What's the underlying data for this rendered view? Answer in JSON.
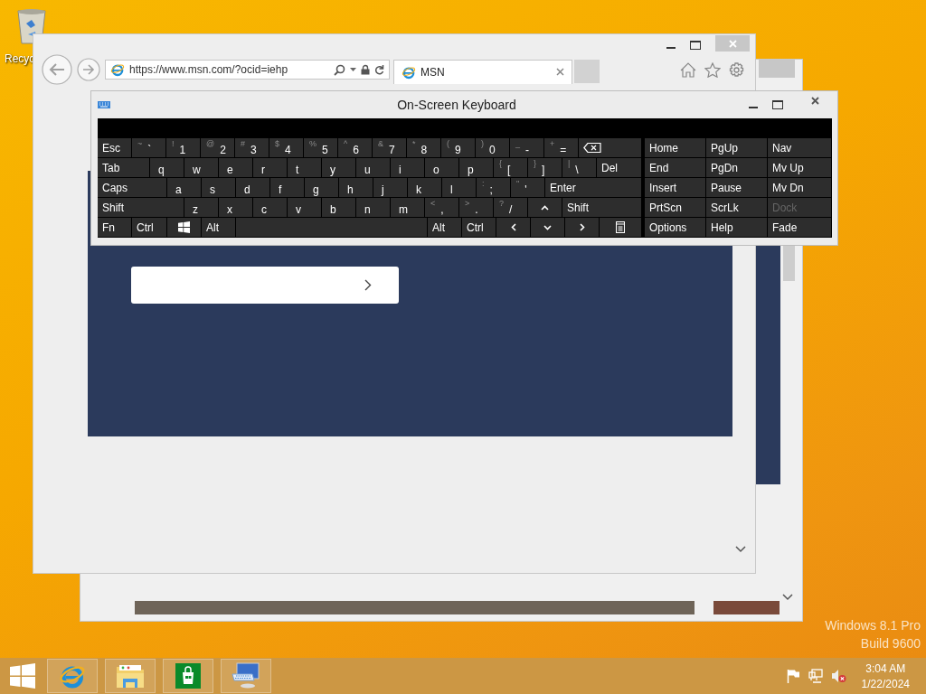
{
  "desktop": {
    "icons": [
      {
        "label": "Recyc"
      }
    ],
    "edition_text": [
      "Windows 8.1 Pro",
      "Build 9600"
    ]
  },
  "browser": {
    "address": "https://www.msn.com/?ocid=iehp",
    "tabs": [
      {
        "label": "MSN",
        "selected": true
      }
    ]
  },
  "keyboard": {
    "title": "On-Screen Keyboard",
    "rows": [
      {
        "keys": [
          {
            "kind": "text",
            "label": "Esc"
          },
          {
            "kind": "char",
            "main": "`",
            "shift": "~"
          },
          {
            "kind": "char",
            "main": "1",
            "shift": "!"
          },
          {
            "kind": "char",
            "main": "2",
            "shift": "@"
          },
          {
            "kind": "char",
            "main": "3",
            "shift": "#"
          },
          {
            "kind": "char",
            "main": "4",
            "shift": "$"
          },
          {
            "kind": "char",
            "main": "5",
            "shift": "%"
          },
          {
            "kind": "char",
            "main": "6",
            "shift": "^"
          },
          {
            "kind": "char",
            "main": "7",
            "shift": "&"
          },
          {
            "kind": "char",
            "main": "8",
            "shift": "*"
          },
          {
            "kind": "char",
            "main": "9",
            "shift": "("
          },
          {
            "kind": "char",
            "main": "0",
            "shift": ")"
          },
          {
            "kind": "char",
            "main": "-",
            "shift": "_"
          },
          {
            "kind": "char",
            "main": "=",
            "shift": "+"
          },
          {
            "kind": "backspace"
          }
        ]
      },
      {
        "keys": [
          {
            "kind": "text",
            "label": "Tab"
          },
          {
            "kind": "char",
            "main": "q"
          },
          {
            "kind": "char",
            "main": "w"
          },
          {
            "kind": "char",
            "main": "e"
          },
          {
            "kind": "char",
            "main": "r"
          },
          {
            "kind": "char",
            "main": "t"
          },
          {
            "kind": "char",
            "main": "y"
          },
          {
            "kind": "char",
            "main": "u"
          },
          {
            "kind": "char",
            "main": "i"
          },
          {
            "kind": "char",
            "main": "o"
          },
          {
            "kind": "char",
            "main": "p"
          },
          {
            "kind": "char",
            "main": "[",
            "shift": "{"
          },
          {
            "kind": "char",
            "main": "]",
            "shift": "}"
          },
          {
            "kind": "char",
            "main": "\\",
            "shift": "|"
          },
          {
            "kind": "text",
            "label": "Del"
          }
        ]
      },
      {
        "keys": [
          {
            "kind": "text",
            "label": "Caps"
          },
          {
            "kind": "char",
            "main": "a"
          },
          {
            "kind": "char",
            "main": "s"
          },
          {
            "kind": "char",
            "main": "d"
          },
          {
            "kind": "char",
            "main": "f"
          },
          {
            "kind": "char",
            "main": "g"
          },
          {
            "kind": "char",
            "main": "h"
          },
          {
            "kind": "char",
            "main": "j"
          },
          {
            "kind": "char",
            "main": "k"
          },
          {
            "kind": "char",
            "main": "l"
          },
          {
            "kind": "char",
            "main": ";",
            "shift": ":"
          },
          {
            "kind": "char",
            "main": "'",
            "shift": "\""
          },
          {
            "kind": "text",
            "label": "Enter"
          }
        ]
      },
      {
        "keys": [
          {
            "kind": "text",
            "label": "Shift"
          },
          {
            "kind": "char",
            "main": "z"
          },
          {
            "kind": "char",
            "main": "x"
          },
          {
            "kind": "char",
            "main": "c"
          },
          {
            "kind": "char",
            "main": "v"
          },
          {
            "kind": "char",
            "main": "b"
          },
          {
            "kind": "char",
            "main": "n"
          },
          {
            "kind": "char",
            "main": "m"
          },
          {
            "kind": "char",
            "main": ",",
            "shift": "<"
          },
          {
            "kind": "char",
            "main": ".",
            "shift": ">"
          },
          {
            "kind": "char",
            "main": "/",
            "shift": "?"
          },
          {
            "kind": "up"
          },
          {
            "kind": "text",
            "label": "Shift"
          }
        ]
      },
      {
        "keys": [
          {
            "kind": "text",
            "label": "Fn"
          },
          {
            "kind": "text",
            "label": "Ctrl"
          },
          {
            "kind": "windows"
          },
          {
            "kind": "text",
            "label": "Alt"
          },
          {
            "kind": "space"
          },
          {
            "kind": "text",
            "label": "Alt"
          },
          {
            "kind": "text",
            "label": "Ctrl"
          },
          {
            "kind": "left"
          },
          {
            "kind": "down"
          },
          {
            "kind": "right"
          },
          {
            "kind": "menu"
          }
        ]
      }
    ],
    "side_keys": [
      {
        "label": "Home",
        "disabled": false
      },
      {
        "label": "PgUp",
        "disabled": false
      },
      {
        "label": "Nav",
        "disabled": false
      },
      {
        "label": "End",
        "disabled": false
      },
      {
        "label": "PgDn",
        "disabled": false
      },
      {
        "label": "Mv Up",
        "disabled": false
      },
      {
        "label": "Insert",
        "disabled": false
      },
      {
        "label": "Pause",
        "disabled": false
      },
      {
        "label": "Mv Dn",
        "disabled": false
      },
      {
        "label": "PrtScn",
        "disabled": false
      },
      {
        "label": "ScrLk",
        "disabled": false
      },
      {
        "label": "Dock",
        "disabled": true
      },
      {
        "label": "Options",
        "disabled": false
      },
      {
        "label": "Help",
        "disabled": false
      },
      {
        "label": "Fade",
        "disabled": false
      }
    ]
  },
  "taskbar": {
    "apps": [
      {
        "kind": "browser"
      },
      {
        "kind": "files"
      },
      {
        "kind": "store"
      },
      {
        "kind": "keyboard"
      }
    ],
    "clock": {
      "time": "3:04 AM",
      "date": "1/22/2024"
    }
  }
}
